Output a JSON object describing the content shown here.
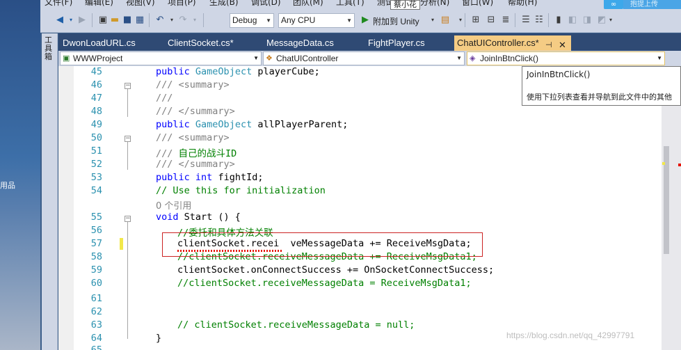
{
  "menu": [
    "文件(F)",
    "编辑(E)",
    "视图(V)",
    "项目(P)",
    "生成(B)",
    "调试(D)",
    "团队(M)",
    "工具(T)",
    "测试",
    "分析(N)",
    "窗口(W)",
    "帮助(H)"
  ],
  "toolbar": {
    "config": "Debug",
    "platform": "Any CPU",
    "run_label": "附加到 Unity",
    "hover_tooltip": "蔡小花",
    "cloud_label": "抱提上传"
  },
  "toolbox_label": "工具箱",
  "desktop_text": "用品",
  "tabs": [
    "DwonLoadURL.cs",
    "ClientSocket.cs*",
    "MessageData.cs",
    "FightPlayer.cs",
    "ChatUIController.cs*"
  ],
  "active_tab": "ChatUIController.cs*",
  "nav": {
    "project": "WWWProject",
    "class": "ChatUIController",
    "member": "JoinInBtnClick()"
  },
  "tooltip": {
    "title": "JoinInBtnClick()",
    "desc": "使用下拉列表查看并导航到此文件中的其他"
  },
  "code": [
    {
      "n": "45",
      "t": "public GameObject playerCube;"
    },
    {
      "n": "46",
      "t": "/// <summary>"
    },
    {
      "n": "47",
      "t": "///"
    },
    {
      "n": "48",
      "t": "/// </summary>"
    },
    {
      "n": "49",
      "t": "public GameObject allPlayerParent;"
    },
    {
      "n": "50",
      "t": "/// <summary>"
    },
    {
      "n": "51",
      "t": "/// 自己的战斗ID"
    },
    {
      "n": "52",
      "t": "/// </summary>"
    },
    {
      "n": "53",
      "t": "public int fightId;"
    },
    {
      "n": "54",
      "t": "// Use this for initialization"
    },
    {
      "n": "",
      "t": "0 个引用"
    },
    {
      "n": "55",
      "t": "void Start () {"
    },
    {
      "n": "56",
      "t": "//委托和具体方法关联"
    },
    {
      "n": "57",
      "t": "clientSocket.recei  veMessageData += ReceiveMsgData;"
    },
    {
      "n": "58",
      "t": "//clientSocket.receiveMessageData += ReceiveMsgData1;"
    },
    {
      "n": "59",
      "t": "clientSocket.onConnectSuccess += OnSocketConnectSuccess;"
    },
    {
      "n": "60",
      "t": "//clientSocket.receiveMessageData = ReceiveMsgData1;"
    },
    {
      "n": "61",
      "t": ""
    },
    {
      "n": "62",
      "t": ""
    },
    {
      "n": "63",
      "t": "// clientSocket.receiveMessageData = null;"
    },
    {
      "n": "64",
      "t": "}"
    },
    {
      "n": "65",
      "t": ""
    }
  ],
  "watermark": "https://blog.csdn.net/qq_42997791",
  "colors": {
    "tab_active": "#f5cc84",
    "tabbar": "#2f4a74",
    "keyword": "#0000ff",
    "type": "#2b91af",
    "comment": "#008000",
    "highlight_box": "#cc2222"
  }
}
